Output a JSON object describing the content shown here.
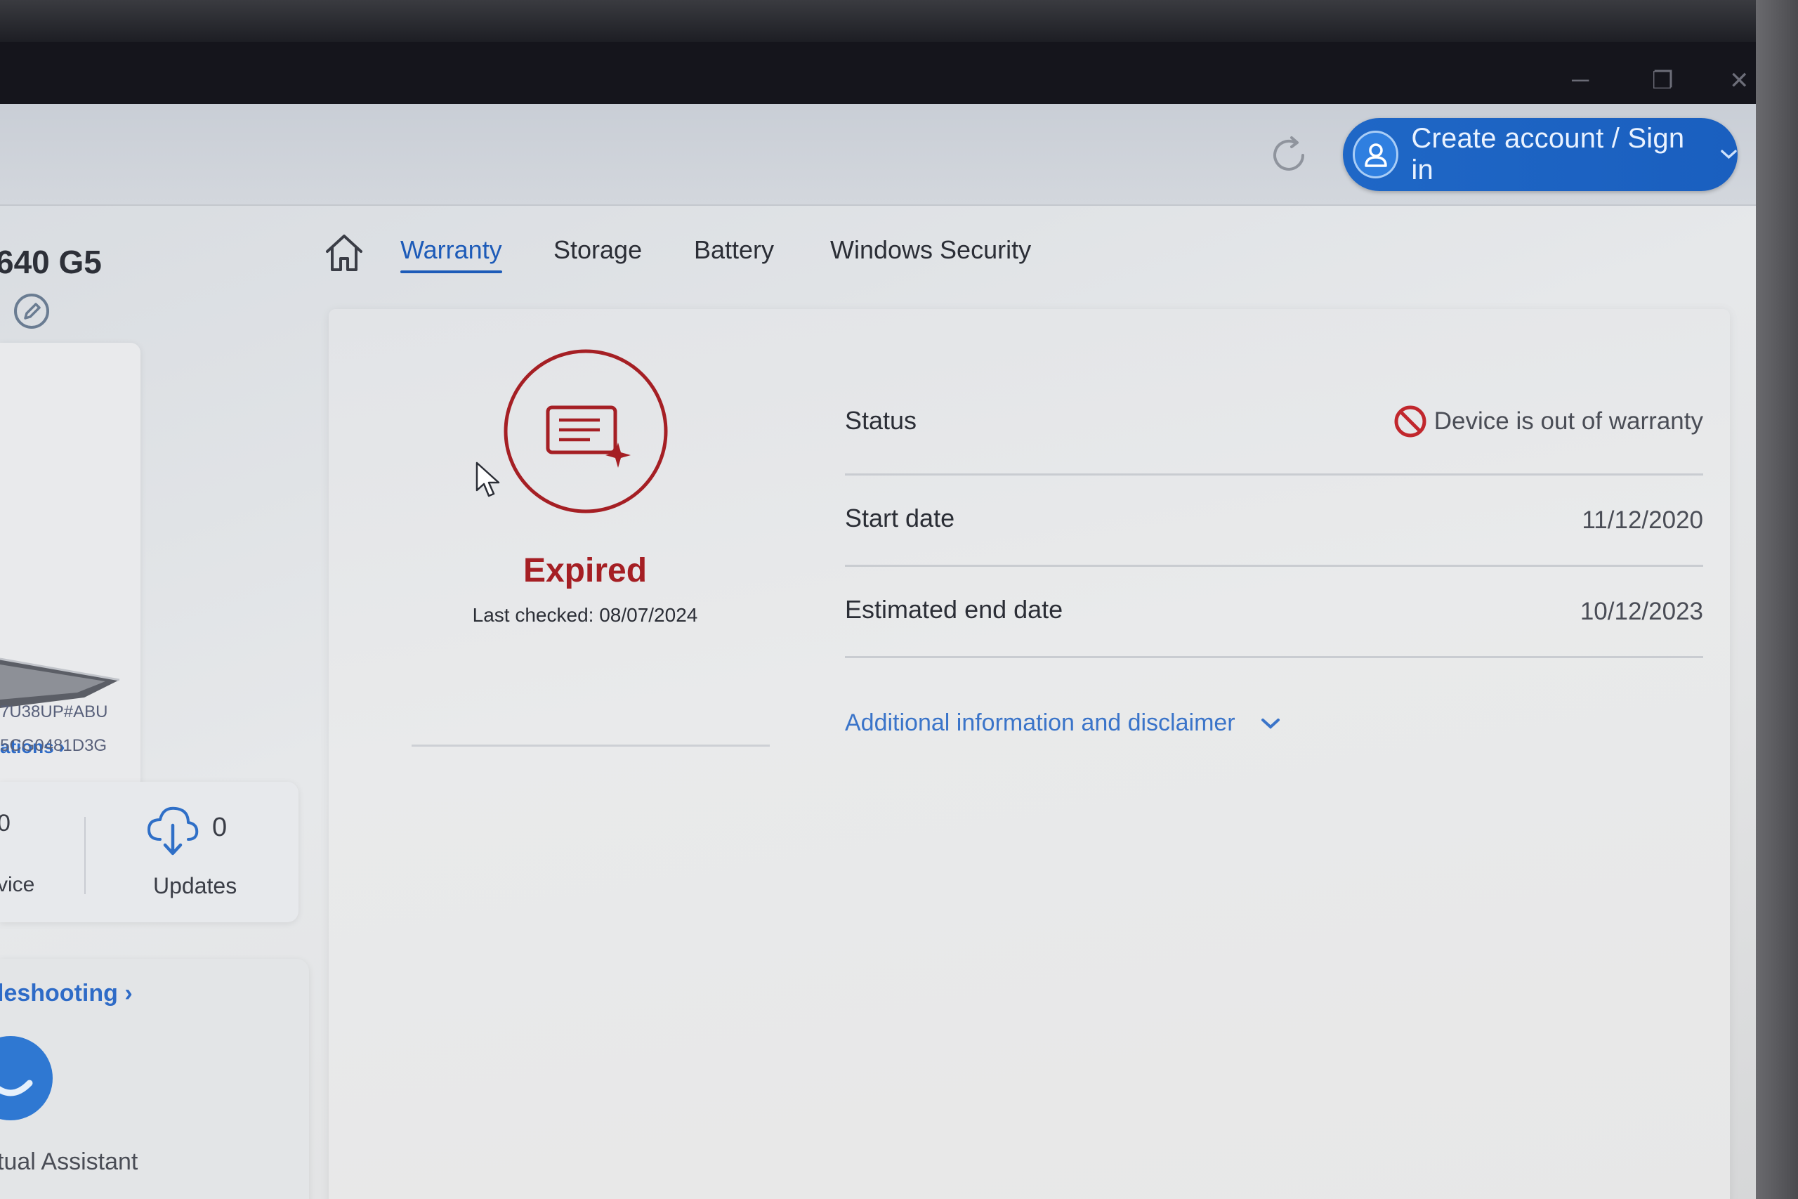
{
  "window": {
    "controls": [
      "minimize",
      "restore",
      "close"
    ]
  },
  "header": {
    "account_button": "Create account / Sign in"
  },
  "sidebar": {
    "device_name": "640 G5",
    "device_card_link": "ations",
    "sku_lines": [
      "7U38UP#ABU",
      "5CG0481D3G"
    ],
    "stats": {
      "left_count": "0",
      "left_label": "vice",
      "updates_count": "0",
      "updates_label": "Updates"
    },
    "troubleshooting_link": "leshooting",
    "virtual_assistant_label": "tual Assistant"
  },
  "tabs": [
    {
      "label": "Warranty",
      "active": true
    },
    {
      "label": "Storage",
      "active": false
    },
    {
      "label": "Battery",
      "active": false
    },
    {
      "label": "Windows Security",
      "active": false
    }
  ],
  "warranty": {
    "state": "Expired",
    "last_checked": "Last checked: 08/07/2024",
    "rows": [
      {
        "key": "Status",
        "value": "Device is out of warranty"
      },
      {
        "key": "Start date",
        "value": "11/12/2020"
      },
      {
        "key": "Estimated end date",
        "value": "10/12/2023"
      }
    ],
    "disclaimer_link": "Additional information and disclaimer"
  },
  "colors": {
    "accent_blue": "#1d5bb8",
    "expired_red": "#a51f24",
    "account_button": "#1f67c6"
  }
}
